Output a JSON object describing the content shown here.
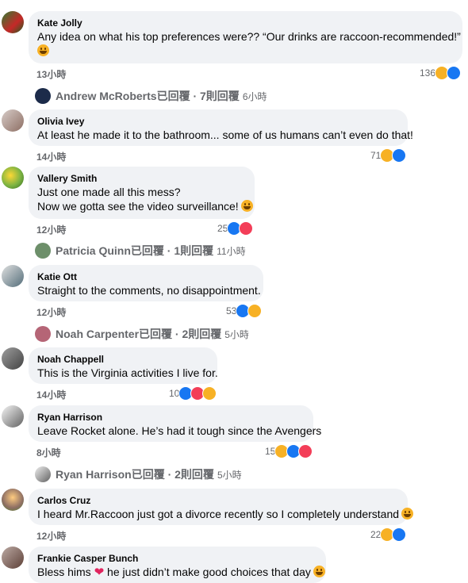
{
  "comments": [
    {
      "author": "Kate Jolly",
      "lines": [
        "Any idea on what his top preferences were?? “Our drinks are raccoon-recommended!”",
        ""
      ],
      "emoji_line": true,
      "time": "13小時",
      "reactions": "136",
      "reply": {
        "name": "Andrew McRoberts已回覆 · 7則回覆",
        "time": "6小時"
      }
    },
    {
      "author": "Olivia Ivey",
      "lines": [
        "At least he made it to the bathroom... some of us humans can’t even do that!"
      ],
      "time": "14小時",
      "reactions": "71"
    },
    {
      "author": "Vallery Smith",
      "lines": [
        "Just one made all this mess?",
        "Now we gotta see the video surveillance!"
      ],
      "time": "12小時",
      "reactions": "25",
      "reply": {
        "name": "Patricia Quinn已回覆 · 1則回覆",
        "time": "11小時"
      }
    },
    {
      "author": "Katie Ott",
      "lines": [
        "Straight to the comments, no disappointment."
      ],
      "time": "12小時",
      "reactions": "53",
      "reply": {
        "name": "Noah Carpenter已回覆 · 2則回覆",
        "time": "5小時"
      }
    },
    {
      "author": "Noah Chappell",
      "lines": [
        "This is the Virginia activities I live for."
      ],
      "time": "14小時",
      "reactions": "10"
    },
    {
      "author": "Ryan Harrison",
      "lines": [
        "Leave Rocket alone. He’s had it tough since the Avengers"
      ],
      "time": "8小時",
      "reactions": "15",
      "reply": {
        "name": "Ryan Harrison已回覆 · 2則回覆",
        "time": "5小時"
      }
    },
    {
      "author": "Carlos Cruz",
      "lines": [
        "I heard Mr.Raccoon just got a divorce recently so I completely understand"
      ],
      "time": "12小時",
      "reactions": "22"
    },
    {
      "author": "Frankie Casper Bunch",
      "lines": [
        "Bless hims",
        "he just didn’t make good choices that day"
      ]
    }
  ],
  "colors": {
    "like": "#1877f2",
    "love": "#f33e58",
    "haha": "#f7b125",
    "bubble": "#f0f2f5",
    "meta": "#65676b"
  }
}
